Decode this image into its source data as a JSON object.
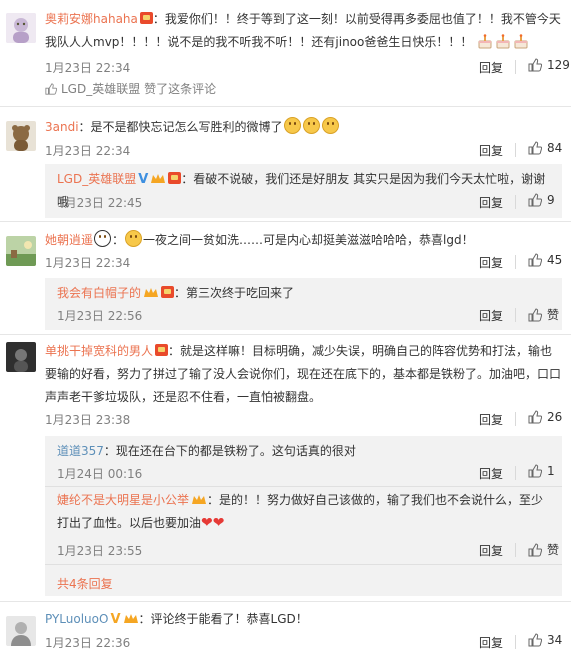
{
  "comments": [
    {
      "name": "奥莉安娜hahaha",
      "text": "：我爱你们！！终于等到了这一刻！以前受得再多委屈也值了！！我不管今天我队人人mvp！！！！说不是的我不听我不听！！还有jinoo爸爸生日快乐！！！",
      "time": "1月23日 22:34",
      "reply": "回复",
      "likes": "129",
      "liked_by": "LGD_英雄联盟",
      "liked_text": "赞了这条评论"
    },
    {
      "name": "3andi",
      "text": "：是不是都快忘记怎么写胜利的微博了",
      "time": "1月23日 22:34",
      "reply": "回复",
      "likes": "84",
      "sub": {
        "name": "LGD_英雄联盟",
        "text": "：看破不说破，我们还是好朋友 其实只是因为我们今天太忙啦，谢谢哦",
        "time": "1月23日 22:45",
        "reply": "回复",
        "likes": "9"
      }
    },
    {
      "name": "她朝逍遥",
      "text": "一夜之间一贫如洗……可是内心却挺美滋滋哈哈哈，恭喜lgd！",
      "time": "1月23日 22:34",
      "reply": "回复",
      "likes": "45",
      "sub": {
        "name": "我会有白帽子的",
        "text": "：第三次终于吃回来了",
        "time": "1月23日 22:56",
        "reply": "回复",
        "likes": "赞"
      }
    },
    {
      "name": "单挑干掉宽科的男人",
      "text": "：就是这样嘛！目标明确，减少失误，明确自己的阵容优势和打法，输也要输的好看，努力了拼过了输了没人会说你们，现在还在底下的，基本都是铁粉了。加油吧，口口声声老干爹垃圾队，还是忍不住看，一直怕被翻盘。",
      "time": "1月23日 23:38",
      "reply": "回复",
      "likes": "26",
      "subs": [
        {
          "name": "道道357",
          "text": "：现在还在台下的都是铁粉了。这句话真的很对",
          "time": "1月24日 00:16",
          "reply": "回复",
          "likes": "1"
        },
        {
          "name": "婕纶不是大明星是小公举",
          "text": "：是的！！努力做好自己该做的，输了我们也不会说什么，至少打出了血性。以后也要加油",
          "time": "1月23日 23:55",
          "reply": "回复",
          "likes": "赞"
        }
      ],
      "more": "共4条回复"
    },
    {
      "name": "PYLuoluoO",
      "text": "：评论终于能看了！恭喜LGD！",
      "time": "1月23日 22:36",
      "reply": "回复",
      "likes": "34"
    }
  ],
  "colors": {
    "name": "#eb7350",
    "name_blue": "#5d8fb8",
    "sub_bg": "#f2f2f2",
    "meta": "#808080"
  },
  "icons": [
    "thumb-up-icon",
    "red-packet-badge",
    "vip-icon",
    "crown-icon",
    "emoji-icon",
    "heart-icon",
    "cake-icon"
  ]
}
